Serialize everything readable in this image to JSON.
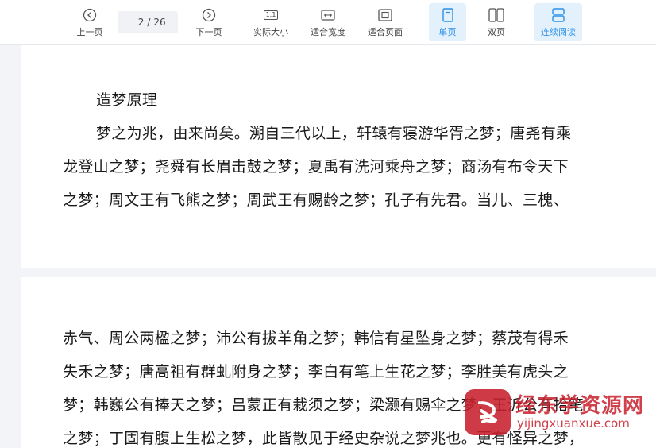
{
  "toolbar": {
    "prev_label": "上一页",
    "next_label": "下一页",
    "current_page": "2",
    "page_sep": "/",
    "total_pages": "26",
    "actual_size_label": "实际大小",
    "actual_size_icon_text": "1:1",
    "fit_width_label": "适合宽度",
    "fit_page_label": "适合页面",
    "single_page_label": "单页",
    "double_page_label": "双页",
    "continuous_label": "连续阅读",
    "active_color": "#2b8fe6",
    "active_bg": "#e3f1fd"
  },
  "page1": {
    "heading": "造梦原理",
    "lines": [
      "梦之为兆，由来尚矣。溯自三代以上，轩辕有寝游华胥之梦；唐尧有乘",
      "龙登山之梦；尧舜有长眉击鼓之梦；夏禹有洗河乘舟之梦；商汤有布令天下",
      "之梦；周文王有飞熊之梦；周武王有赐龄之梦；孔子有先君。当儿、三槐、"
    ]
  },
  "page2": {
    "lines": [
      "赤气、周公两楹之梦；沛公有拔羊角之梦；韩信有星坠身之梦；蔡茂有得禾",
      "失禾之梦；唐高祖有群虬附身之梦；李白有笔上生花之梦；李胜美有虎头之",
      "梦；韩巍公有捧天之梦；吕蒙正有栽须之梦；梁灏有赐伞之梦；王沂公有拾笔",
      "之梦；丁固有腹上生松之梦，此皆散见于经史杂说之梦兆也。更有怪异之梦，"
    ]
  },
  "watermark": {
    "title": "经东学资源网",
    "url": "yijingxuanxue.com",
    "color": "#c8202d"
  }
}
